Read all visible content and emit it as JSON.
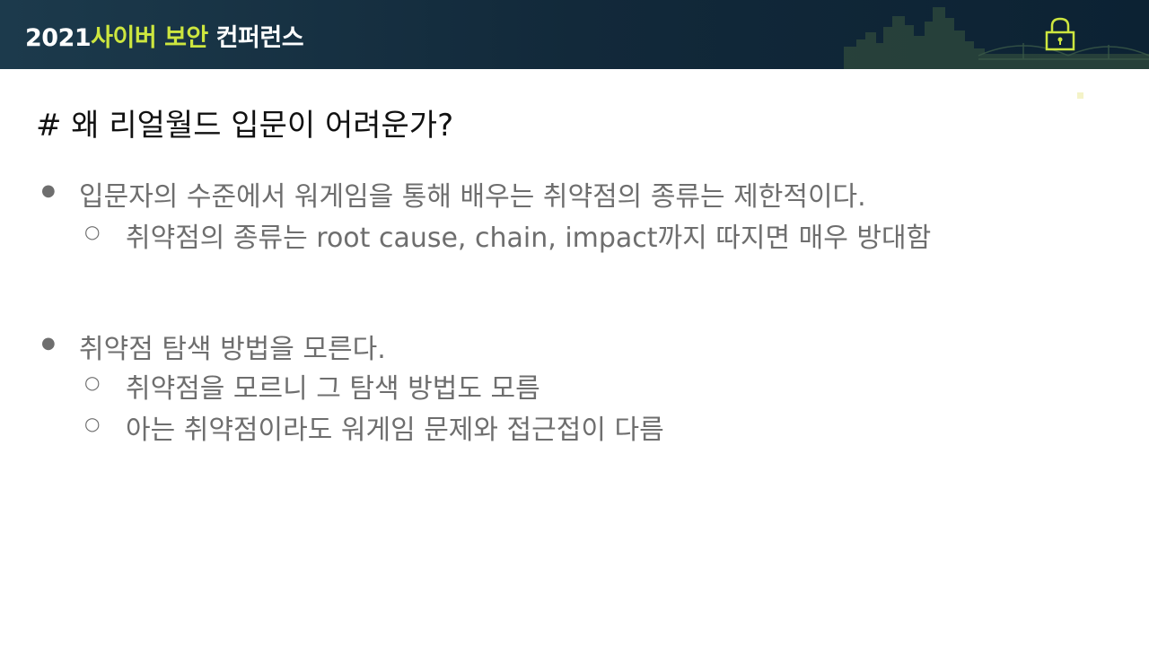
{
  "header": {
    "title_year": "2021",
    "title_highlight": "사이버 보안",
    "title_rest": "컨퍼런스",
    "lock_icon": "padlock-icon",
    "skyline": "city-skyline-bridge-graphic"
  },
  "slide": {
    "heading": "# 왜 리얼월드 입문이 어려운가?",
    "bullet_marker_l1": "●",
    "bullet_marker_l2": "○",
    "items": [
      {
        "text": "입문자의 수준에서 워게임을 통해 배우는 취약점의 종류는 제한적이다.",
        "sub": [
          {
            "text": "취약점의 종류는 root cause, chain, impact까지 따지면 매우 방대함"
          }
        ]
      },
      {
        "text": "취약점 탐색 방법을 모른다.",
        "sub": [
          {
            "text": "취약점을 모르니 그 탐색 방법도 모름"
          },
          {
            "text": "아는 취약점이라도 워게임 문제와 접근접이 다름"
          }
        ]
      }
    ]
  },
  "colors": {
    "header_bg": "#12293a",
    "accent_green": "#cde63f",
    "body_text": "#6e6e6e",
    "heading_text": "#111111"
  }
}
